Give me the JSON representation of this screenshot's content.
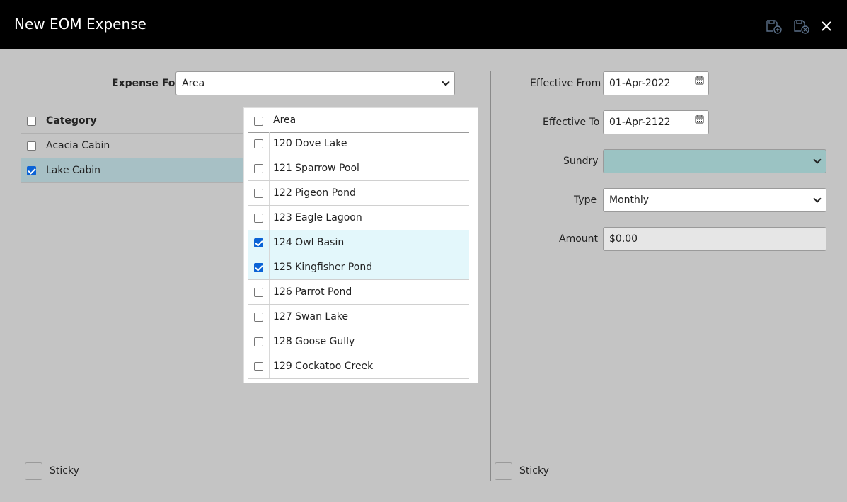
{
  "window": {
    "title": "New EOM Expense"
  },
  "left": {
    "expense_for_label": "Expense For",
    "expense_for_value": "Area",
    "category_table": {
      "header": "Category",
      "rows": [
        {
          "label": "Acacia Cabin",
          "checked": false
        },
        {
          "label": "Lake Cabin",
          "checked": true
        }
      ]
    },
    "sticky_label": "Sticky"
  },
  "area_popup": {
    "header": "Area",
    "rows": [
      {
        "label": "120 Dove Lake",
        "checked": false
      },
      {
        "label": "121 Sparrow Pool",
        "checked": false
      },
      {
        "label": "122 Pigeon Pond",
        "checked": false
      },
      {
        "label": "123 Eagle Lagoon",
        "checked": false
      },
      {
        "label": "124 Owl Basin",
        "checked": true
      },
      {
        "label": "125 Kingfisher Pond",
        "checked": true
      },
      {
        "label": "126 Parrot Pond",
        "checked": false
      },
      {
        "label": "127 Swan Lake",
        "checked": false
      },
      {
        "label": "128 Goose Gully",
        "checked": false
      },
      {
        "label": "129 Cockatoo Creek",
        "checked": false
      }
    ]
  },
  "right": {
    "effective_from_label": "Effective From",
    "effective_from_value": "01-Apr-2022",
    "effective_to_label": "Effective To",
    "effective_to_value": "01-Apr-2122",
    "sundry_label": "Sundry",
    "sundry_value": "",
    "type_label": "Type",
    "type_value": "Monthly",
    "amount_label": "Amount",
    "amount_value": "$0.00",
    "sticky_label": "Sticky"
  },
  "colors": {
    "titlebar": "#000000",
    "background": "#c4c4c4",
    "checkbox_checked": "#0b63d6",
    "selected_row": "#a7c0c5",
    "popup_checked_row": "#e3f7fb",
    "sundry_select": "#9bc3c3"
  }
}
